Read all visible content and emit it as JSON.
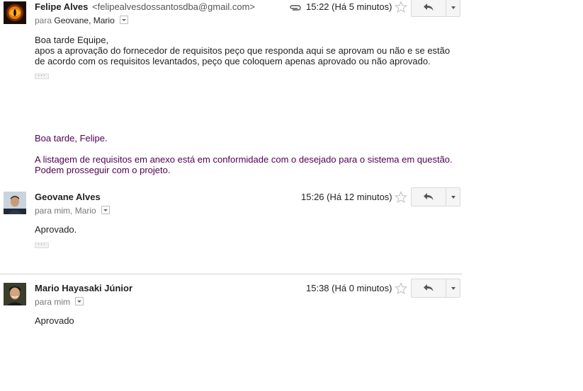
{
  "messages": [
    {
      "sender_name": "Felipe Alves",
      "sender_email": "<felipealvesdossantosdba@gmail.com>",
      "recipients_prefix": "para",
      "recipients": "Geovane, Mario",
      "time": "15:22 (Há 5 minutos)",
      "has_attachment_icon": true,
      "body_lines": [
        "Boa tarde Equipe,",
        "apos a aprovação do fornecedor de requisitos peço que responda aqui se aprovam ou não e se estão",
        "de acordo com os requisitos levantados, peço que coloquem apenas aprovado ou não aprovado."
      ],
      "quoted_lines": [
        "Boa tarde, Felipe.",
        "A listagem de requisitos em anexo está em conformidade com o desejado para o sistema em questão.",
        "Podem prosseguir com o projeto."
      ]
    },
    {
      "sender_name": "Geovane Alves",
      "recipients_prefix": "para",
      "recipients": "mim, Mario",
      "time": "15:26 (Há 12 minutos)",
      "body_lines": [
        "Aprovado."
      ]
    },
    {
      "sender_name": "Mario Hayasaki Júnior",
      "recipients_prefix": "para",
      "recipients": "mim",
      "time": "15:38 (Há 0 minutos)",
      "body_lines": [
        "Aprovado"
      ]
    }
  ],
  "icons": {
    "attachment": "paperclip-icon",
    "star": "star-outline-icon",
    "reply": "reply-arrow-icon",
    "more": "chevron-down-icon",
    "recipient_details": "caret-down-icon"
  },
  "colors": {
    "quoted_text": "#500050",
    "divider": "#cfcfcf",
    "button_bg": "#f5f5f5"
  }
}
